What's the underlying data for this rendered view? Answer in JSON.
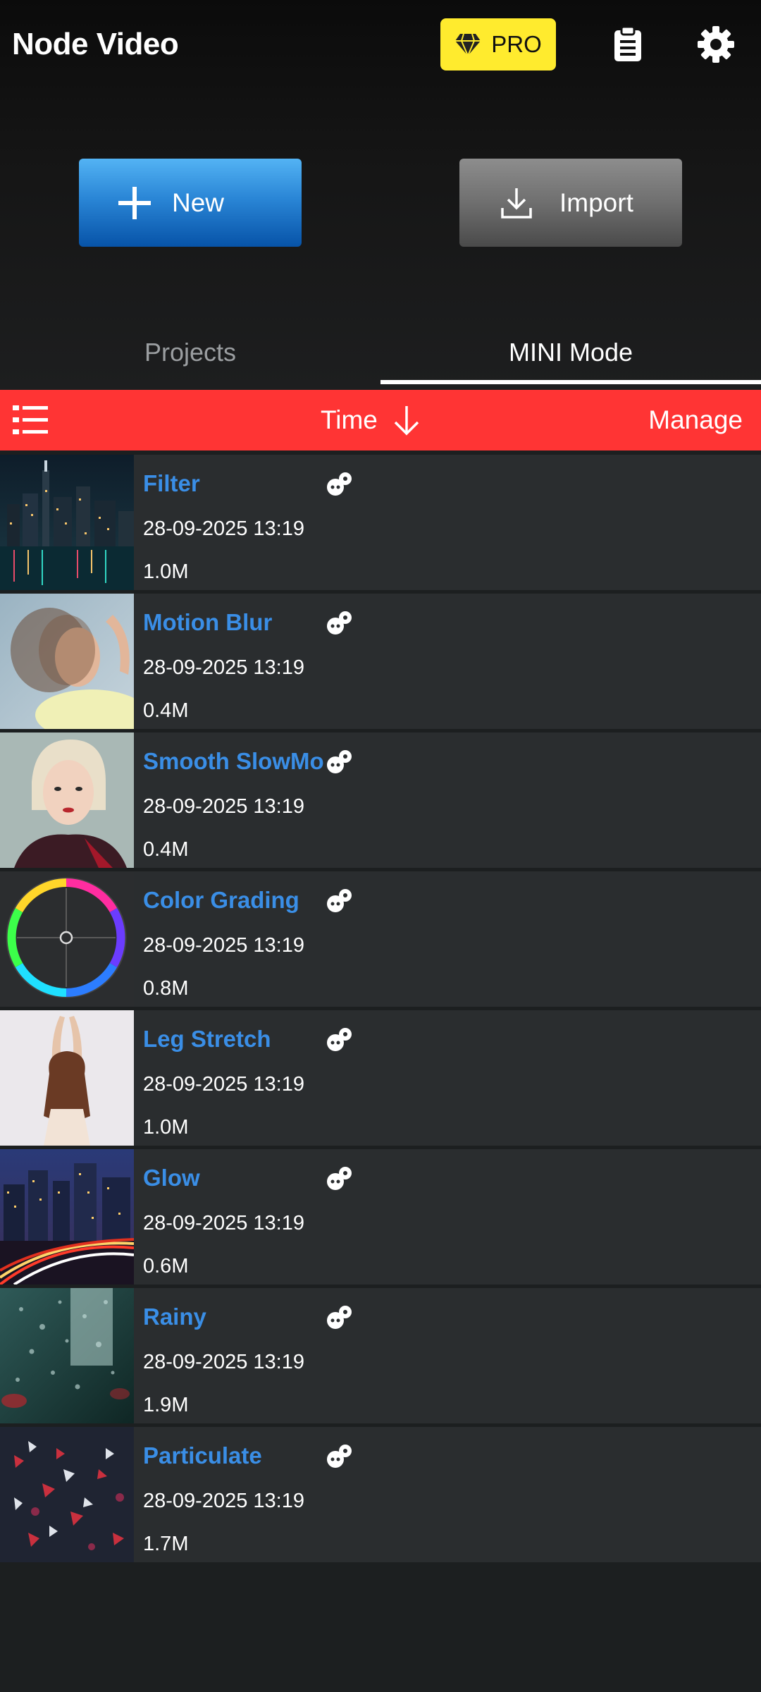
{
  "header": {
    "app_title": "Node Video",
    "pro_label": "PRO",
    "pro_color": "#ffeb2e",
    "clipboard_icon": "clipboard-icon",
    "settings_icon": "gear-icon"
  },
  "actions": {
    "new_label": "New",
    "import_label": "Import"
  },
  "tabs": [
    {
      "label": "Projects",
      "active": false
    },
    {
      "label": "MINI Mode",
      "active": true
    }
  ],
  "sortbar": {
    "sort_label": "Time",
    "sort_direction": "descending",
    "manage_label": "Manage",
    "accent": "#ff3434"
  },
  "projects": [
    {
      "title": "Filter",
      "date": "28-09-2025 13:19",
      "size": "1.0M",
      "thumb": "city-night"
    },
    {
      "title": "Motion Blur",
      "date": "28-09-2025 13:19",
      "size": "0.4M",
      "thumb": "blurred-woman"
    },
    {
      "title": "Smooth SlowMo",
      "date": "28-09-2025 13:19",
      "size": "0.4M",
      "thumb": "portrait-woman"
    },
    {
      "title": "Color Grading",
      "date": "28-09-2025 13:19",
      "size": "0.8M",
      "thumb": "color-wheel"
    },
    {
      "title": "Leg Stretch",
      "date": "28-09-2025 13:19",
      "size": "1.0M",
      "thumb": "stretching-woman"
    },
    {
      "title": "Glow",
      "date": "28-09-2025 13:19",
      "size": "0.6M",
      "thumb": "night-traffic"
    },
    {
      "title": "Rainy",
      "date": "28-09-2025 13:19",
      "size": "1.9M",
      "thumb": "rain-window"
    },
    {
      "title": "Particulate",
      "date": "28-09-2025 13:19",
      "size": "1.7M",
      "thumb": "particles"
    }
  ]
}
